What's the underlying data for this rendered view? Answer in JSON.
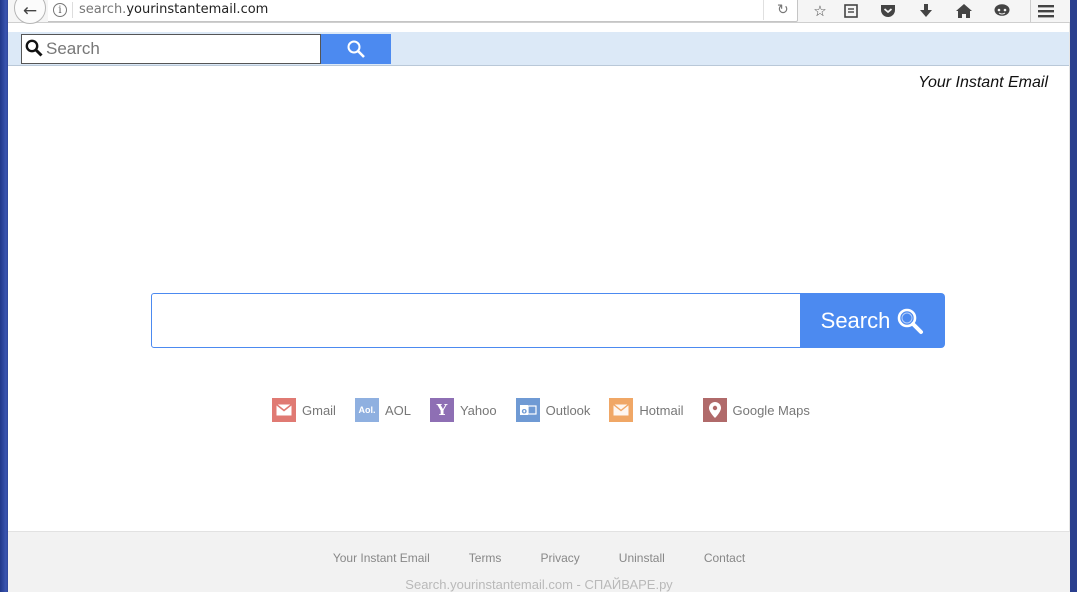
{
  "browser": {
    "url_prefix": "search.",
    "url_domain": "yourinstantemail.com",
    "icons": [
      "back-icon",
      "info-icon",
      "reload-icon",
      "bookmark-star-icon",
      "reader-list-icon",
      "pocket-icon",
      "download-icon",
      "home-icon",
      "chat-icon",
      "menu-icon"
    ]
  },
  "toolbar_search": {
    "placeholder": "Search"
  },
  "brand": {
    "name": "Your Instant Email"
  },
  "main_search": {
    "value": "",
    "button_label": "Search"
  },
  "quick_links": [
    {
      "label": "Gmail",
      "color": "#e07a73",
      "glyph": "✉"
    },
    {
      "label": "AOL",
      "color": "#8fb0e0",
      "glyph": "Aol."
    },
    {
      "label": "Yahoo",
      "color": "#8e6fb4",
      "glyph": "Y!"
    },
    {
      "label": "Outlook",
      "color": "#6f9ad4",
      "glyph": "O"
    },
    {
      "label": "Hotmail",
      "color": "#f0a766",
      "glyph": "✉"
    },
    {
      "label": "Google Maps",
      "color": "#b06a6a",
      "glyph": "⚲"
    }
  ],
  "footer": {
    "links": [
      "Your Instant Email",
      "Terms",
      "Privacy",
      "Uninstall",
      "Contact"
    ],
    "watermark": "Search.yourinstantemail.com - СПАЙВАРЕ.ру"
  },
  "colors": {
    "accent": "#4c8af0",
    "strip_bg": "#dce9f7"
  }
}
